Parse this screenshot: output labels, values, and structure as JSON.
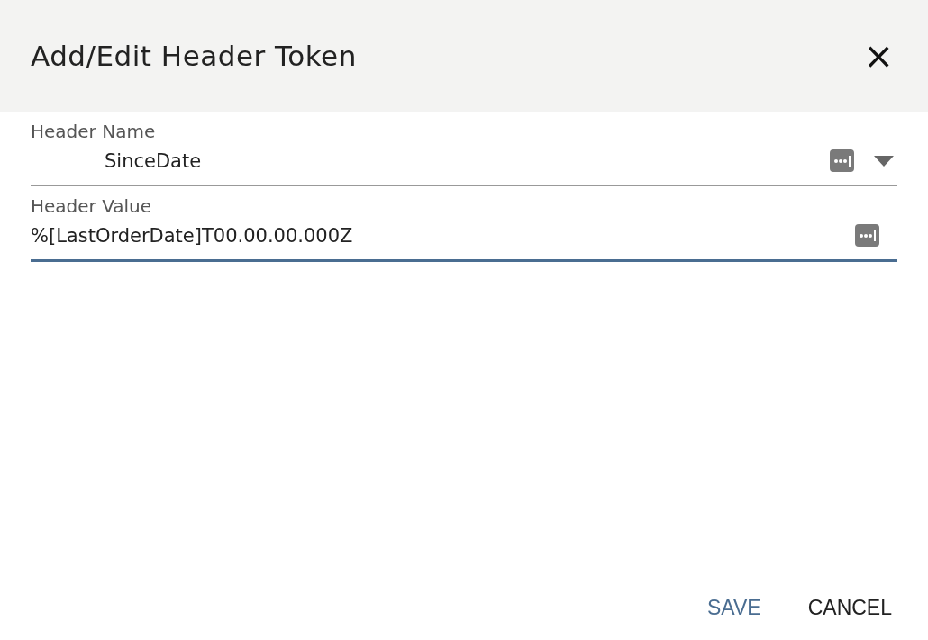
{
  "dialog": {
    "title": "Add/Edit Header Token",
    "close": "×"
  },
  "fields": [
    {
      "kind": "select",
      "label": "Header Name",
      "value": "SinceDate",
      "focused": false
    },
    {
      "kind": "text",
      "label": "Header Value",
      "value": "%[LastOrderDate]T00.00.00.000Z",
      "focused": true
    }
  ],
  "buttons": [
    {
      "label": "SAVE",
      "kind": "primary"
    },
    {
      "label": "CANCEL",
      "kind": "secondary"
    }
  ]
}
